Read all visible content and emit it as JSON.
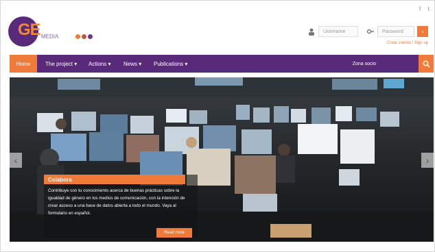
{
  "social": {
    "icon_f": "f",
    "icon_t": "t"
  },
  "logo": {
    "text": "GE",
    "sub_text": "MEDIA",
    "colors": [
      "#5a2a7a",
      "#f07a3a",
      "#6a3a8a"
    ]
  },
  "login": {
    "username_placeholder": "Username",
    "password_placeholder": "Password",
    "submit_label": "›",
    "register_link": "Crear cuenta / Sign up"
  },
  "nav": {
    "items": [
      {
        "label": "Home"
      },
      {
        "label": "The project ▾"
      },
      {
        "label": "Actions ▾"
      },
      {
        "label": "News ▾"
      },
      {
        "label": "Publications ▾"
      }
    ],
    "search_text": "Zona socio",
    "search_icon": "⌕"
  },
  "hero": {
    "caption": {
      "title": "Colabora",
      "text": "Contribuye con tu conocimiento acerca de buenas prácticas sobre la igualdad de género en los medios de comunicación, con la intención de crear acceso a una base de datos abierta a todo el mundo. Vaya al formulario en español.",
      "button_label": "Read more"
    },
    "left_arrow": "‹",
    "right_arrow": "›"
  },
  "colors": {
    "purple": "#5a2a7a",
    "orange": "#f07a3a"
  }
}
